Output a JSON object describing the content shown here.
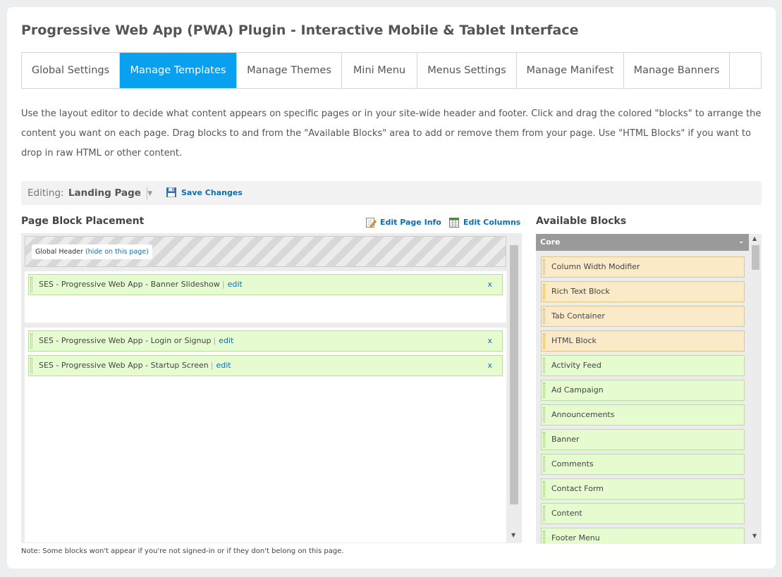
{
  "page_title": "Progressive Web App (PWA) Plugin - Interactive Mobile & Tablet Interface",
  "tabs": [
    {
      "label": "Global Settings"
    },
    {
      "label": "Manage Templates",
      "active": true
    },
    {
      "label": "Manage Themes"
    },
    {
      "label": "Mini Menu"
    },
    {
      "label": "Menus Settings"
    },
    {
      "label": "Manage Manifest"
    },
    {
      "label": "Manage Banners"
    }
  ],
  "intro_text": "Use the layout editor to decide what content appears on specific pages or in your site-wide header and footer. Click and drag the colored \"blocks\" to arrange the content you want on each page. Drag blocks to and from the \"Available Blocks\" area to add or remove them from your page. Use \"HTML Blocks\" if you want to drop in raw HTML or other content.",
  "editor": {
    "editing_label": "Editing:",
    "editing_page": "Landing Page",
    "save_label": "Save Changes"
  },
  "placement": {
    "title": "Page Block Placement",
    "edit_page_info": "Edit Page Info",
    "edit_columns": "Edit Columns",
    "global_header": "Global Header",
    "hide_link": "(hide on this page)",
    "top_blocks": [
      {
        "name": "SES - Progressive Web App - Banner Slideshow",
        "edit": "edit",
        "remove": "x"
      }
    ],
    "main_blocks": [
      {
        "name": "SES - Progressive Web App - Login or Signup",
        "edit": "edit",
        "remove": "x"
      },
      {
        "name": "SES - Progressive Web App - Startup Screen",
        "edit": "edit",
        "remove": "x"
      }
    ]
  },
  "available": {
    "title": "Available Blocks",
    "group_label": "Core",
    "collapse_symbol": "–",
    "blocks": [
      {
        "label": "Column Width Modifier",
        "kind": "layout"
      },
      {
        "label": "Rich Text Block",
        "kind": "layout"
      },
      {
        "label": "Tab Container",
        "kind": "layout"
      },
      {
        "label": "HTML Block",
        "kind": "layout"
      },
      {
        "label": "Activity Feed",
        "kind": "content"
      },
      {
        "label": "Ad Campaign",
        "kind": "content"
      },
      {
        "label": "Announcements",
        "kind": "content"
      },
      {
        "label": "Banner",
        "kind": "content"
      },
      {
        "label": "Comments",
        "kind": "content"
      },
      {
        "label": "Contact Form",
        "kind": "content"
      },
      {
        "label": "Content",
        "kind": "content"
      },
      {
        "label": "Footer Menu",
        "kind": "content"
      }
    ]
  },
  "note": "Note: Some blocks won't appear if you're not signed-in or if they don't belong on this page.",
  "colors": {
    "accent": "#0aa0f0",
    "link": "#0b6fb0",
    "block_green": "#e6fbd0",
    "block_orange": "#fbeac8"
  },
  "icons": {
    "save": "floppy-disk-icon",
    "edit_page_info": "pencil-page-icon",
    "edit_columns": "columns-grid-icon",
    "dropdown": "caret-down-icon"
  }
}
